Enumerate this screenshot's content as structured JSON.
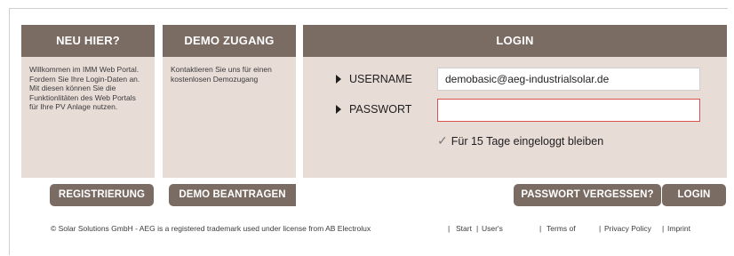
{
  "new_here": {
    "title": "NEU HIER?",
    "text": "Willkommen im IMM Web Portal. Fordern Sie Ihre Login-Daten an. Mit diesen können Sie die Funktionlitäten des Web Portals für Ihre PV Anlage nutzen."
  },
  "demo": {
    "title": "DEMO ZUGANG",
    "text": "Kontaktieren Sie uns für einen kostenlosen Demozugang"
  },
  "login": {
    "title": "LOGIN",
    "username_label": "USERNAME",
    "username_value": "demobasic@aeg-industrialsolar.de",
    "password_label": "PASSWORT",
    "password_value": "",
    "remember_label": "Für 15 Tage eingeloggt bleiben",
    "remember_checked": true
  },
  "buttons": {
    "register": "REGISTRIERUNG",
    "demo_request": "DEMO BEANTRAGEN",
    "forgot_password": "PASSWORT VERGESSEN?",
    "login": "LOGIN"
  },
  "footer": {
    "copyright": "© Solar Solutions GmbH - AEG is a registered trademark used under license from AB Electrolux",
    "links": [
      "Start",
      "User's",
      "Terms of",
      "Privacy Policy",
      "Imprint"
    ]
  },
  "colors": {
    "header_bg": "#7a6b63",
    "panel_bg": "#e8dcd7",
    "error_border": "#d9534f"
  }
}
